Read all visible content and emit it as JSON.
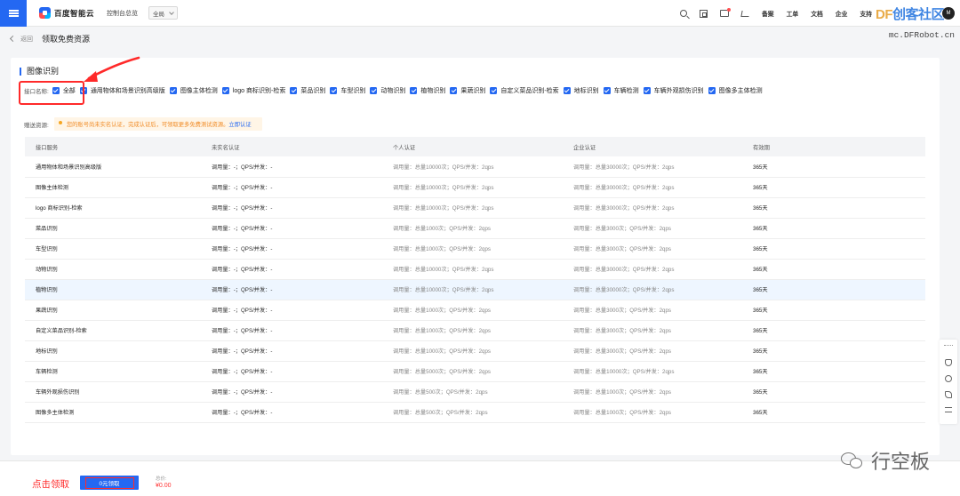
{
  "topbar": {
    "logo_text": "百度智能云",
    "console": "控制台总览",
    "region": "全局",
    "links": [
      "备案",
      "工单",
      "文档",
      "企业",
      "支持"
    ],
    "avatar_text": "M"
  },
  "watermark": {
    "brand_df": "DF",
    "brand_rest": "创客社区",
    "url": "mc.DFRobot.cn",
    "bottom": "行空板"
  },
  "breadcrumb": {
    "back": "返回",
    "title": "领取免费资源"
  },
  "section_title": "图像识别",
  "filter": {
    "label": "接口名称:",
    "options": [
      "全部",
      "通用物体和场景识别高级版",
      "图像主体检测",
      "logo 商标识别-检索",
      "菜品识别",
      "车型识别",
      "动物识别",
      "植物识别",
      "果蔬识别",
      "自定义菜品识别-检索",
      "地标识别",
      "车辆检测",
      "车辆外观损伤识别",
      "图像多主体检测"
    ]
  },
  "gift": {
    "label": "赠送资源:",
    "notice": "您的账号尚未实名认证，完成认证后，可领取更多免费测试资源。",
    "link": "立即认证"
  },
  "table": {
    "headers": [
      "接口服务",
      "未实名认证",
      "个人认证",
      "企业认证",
      "有效期"
    ],
    "rows": [
      [
        "通用物体和场景识别高级版",
        "调用量：-；QPS/并发：-",
        "调用量：总量10000次；QPS/并发：2qps",
        "调用量：总量30000次；QPS/并发：2qps",
        "365天"
      ],
      [
        "图像主体检测",
        "调用量：-；QPS/并发：-",
        "调用量：总量10000次；QPS/并发：2qps",
        "调用量：总量30000次；QPS/并发：2qps",
        "365天"
      ],
      [
        "logo 商标识别-检索",
        "调用量：-；QPS/并发：-",
        "调用量：总量10000次；QPS/并发：2qps",
        "调用量：总量30000次；QPS/并发：2qps",
        "365天"
      ],
      [
        "菜品识别",
        "调用量：-；QPS/并发：-",
        "调用量：总量1000次；QPS/并发：2qps",
        "调用量：总量3000次；QPS/并发：2qps",
        "365天"
      ],
      [
        "车型识别",
        "调用量：-；QPS/并发：-",
        "调用量：总量1000次；QPS/并发：2qps",
        "调用量：总量3000次；QPS/并发：2qps",
        "365天"
      ],
      [
        "动物识别",
        "调用量：-；QPS/并发：-",
        "调用量：总量10000次；QPS/并发：2qps",
        "调用量：总量30000次；QPS/并发：2qps",
        "365天"
      ],
      [
        "植物识别",
        "调用量：-；QPS/并发：-",
        "调用量：总量10000次；QPS/并发：2qps",
        "调用量：总量30000次；QPS/并发：2qps",
        "365天"
      ],
      [
        "果蔬识别",
        "调用量：-；QPS/并发：-",
        "调用量：总量1000次；QPS/并发：2qps",
        "调用量：总量3000次；QPS/并发：2qps",
        "365天"
      ],
      [
        "自定义菜品识别-检索",
        "调用量：-；QPS/并发：-",
        "调用量：总量1000次；QPS/并发：2qps",
        "调用量：总量3000次；QPS/并发：2qps",
        "365天"
      ],
      [
        "地标识别",
        "调用量：-；QPS/并发：-",
        "调用量：总量1000次；QPS/并发：2qps",
        "调用量：总量3000次；QPS/并发：2qps",
        "365天"
      ],
      [
        "车辆检测",
        "调用量：-；QPS/并发：-",
        "调用量：总量5000次；QPS/并发：2qps",
        "调用量：总量10000次；QPS/并发：2qps",
        "365天"
      ],
      [
        "车辆外观损伤识别",
        "调用量：-；QPS/并发：-",
        "调用量：总量500次；QPS/并发：2qps",
        "调用量：总量1000次；QPS/并发：2qps",
        "365天"
      ],
      [
        "图像多主体检测",
        "调用量：-；QPS/并发：-",
        "调用量：总量500次；QPS/并发：2qps",
        "调用量：总量1000次；QPS/并发：2qps",
        "365天"
      ]
    ],
    "highlighted_row": 6
  },
  "bottom": {
    "annotation": "点击领取",
    "claim_button": "0元领取",
    "price_label": "总价:",
    "price_value": "¥0.00"
  },
  "colors": {
    "primary": "#2468f2",
    "annotation": "#ff2a2a",
    "warning": "#f08a24"
  }
}
